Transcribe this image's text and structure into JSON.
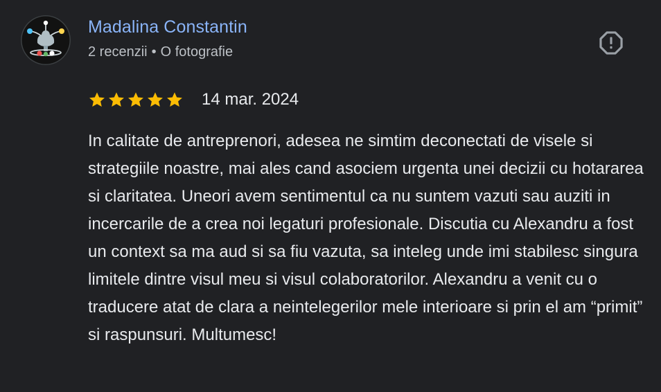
{
  "reviewer": {
    "name": "Madalina Constantin",
    "reviews_count": "2 recenzii",
    "separator": "•",
    "photos_count": "O fotografie",
    "avatar_icon": "tree-of-life-avatar-icon"
  },
  "review": {
    "rating": 5,
    "rating_max": 5,
    "star_color": "#fbbc04",
    "date": "14 mar. 2024",
    "text": "In calitate de antreprenori, adesea ne simtim deconectati de visele si strategiile noastre, mai ales cand asociem urgenta unei decizii cu hotararea si claritatea. Uneori avem sentimentul ca nu suntem vazuti sau auziti in incercarile de a crea noi legaturi profesionale. Discutia cu Alexandru a fost un context sa ma aud si sa fiu vazuta, sa inteleg unde imi stabilesc singura limitele dintre visul meu si visul colaboratorilor. Alexandru a venit cu o traducere atat de clara a neintelegerilor mele interioare si prin el am “primit” si raspunsuri. Multumesc!"
  },
  "actions": {
    "report_icon": "report-octagon-icon"
  },
  "colors": {
    "background": "#202124",
    "name": "#8ab4f8",
    "meta": "#bdc1c6",
    "text": "#e8eaed",
    "icon": "#9aa0a6"
  }
}
